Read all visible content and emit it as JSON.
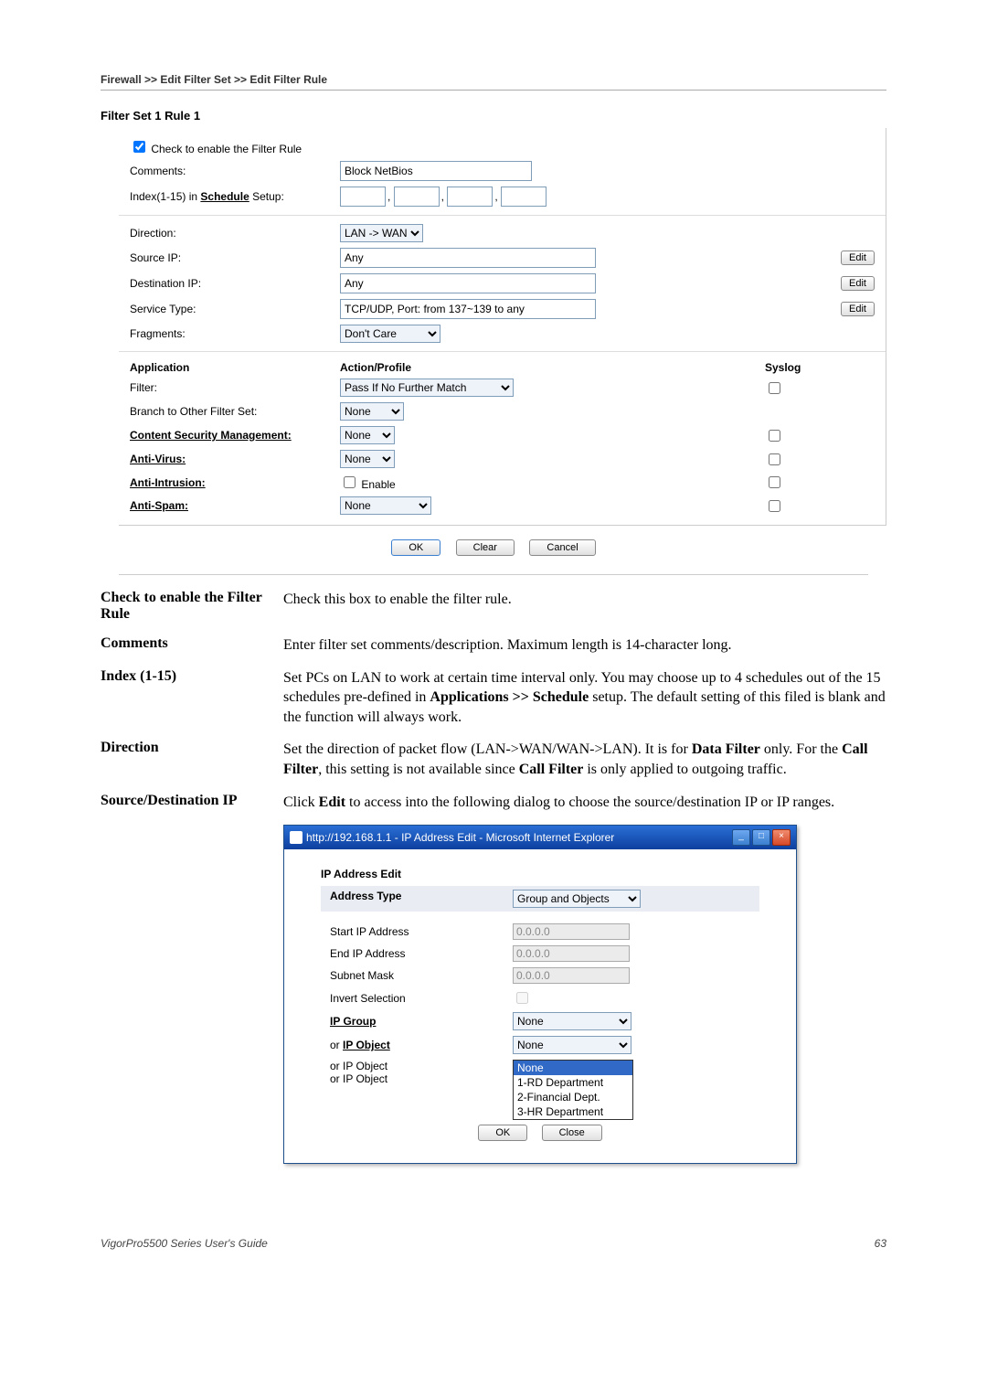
{
  "breadcrumb": "Firewall >> Edit Filter Set >> Edit Filter Rule",
  "filter_title": "Filter Set 1 Rule 1",
  "checkbox_label": "Check to enable the Filter Rule",
  "rows": {
    "comments_label": "Comments:",
    "comments_value": "Block NetBios",
    "index_label": "Index(1-15) in",
    "index_link": "Schedule",
    "index_suffix": "Setup:",
    "direction_label": "Direction:",
    "direction_value": "LAN -> WAN",
    "source_ip_label": "Source IP:",
    "source_ip_value": "Any",
    "dest_ip_label": "Destination IP:",
    "dest_ip_value": "Any",
    "service_type_label": "Service Type:",
    "service_type_value": "TCP/UDP, Port: from 137~139 to any",
    "fragments_label": "Fragments:",
    "fragments_value": "Don't Care",
    "edit_btn": "Edit"
  },
  "headers": {
    "application": "Application",
    "action_profile": "Action/Profile",
    "syslog": "Syslog"
  },
  "app_rows": {
    "filter_label": "Filter:",
    "filter_value": "Pass If No Further Match",
    "branch_label": "Branch to Other Filter Set:",
    "branch_value": "None",
    "csm_label": "Content Security Management:",
    "csm_value": "None",
    "av_label": "Anti-Virus:",
    "av_value": "None",
    "ai_label": "Anti-Intrusion:",
    "ai_checkbox": "Enable",
    "as_label": "Anti-Spam:",
    "as_value": "None"
  },
  "buttons": {
    "ok": "OK",
    "clear": "Clear",
    "cancel": "Cancel"
  },
  "descriptions": {
    "check_label": "Check to enable the Filter Rule",
    "check_text": "Check this box to enable the filter rule.",
    "comments_label": "Comments",
    "comments_text": "Enter filter set comments/description. Maximum length is 14-character long.",
    "index_label": "Index (1-15)",
    "index_text_pre": "Set PCs on LAN to work at certain time interval only. You may choose up to 4 schedules out of the 15 schedules pre-defined in ",
    "index_bold": "Applications >> Schedule",
    "index_text_post": " setup. The default setting of this filed is blank and the function will always work.",
    "direction_label": "Direction",
    "direction_text_pre": "Set the direction of packet flow (LAN->WAN/WAN->LAN). It is for ",
    "direction_b1": "Data Filter",
    "direction_mid1": " only. For the ",
    "direction_b2": "Call Filter",
    "direction_mid2": ", this setting is not available since ",
    "direction_b3": "Call Filter",
    "direction_post": " is only applied to outgoing traffic.",
    "srcdest_label": "Source/Destination IP",
    "srcdest_pre": "Click ",
    "srcdest_bold": "Edit",
    "srcdest_post": " to access into the following dialog to choose the source/destination IP or IP ranges."
  },
  "ie": {
    "title": "http://192.168.1.1 - IP Address Edit - Microsoft Internet Explorer",
    "section": "IP Address Edit",
    "address_type_label": "Address Type",
    "address_type_value": "Group and Objects",
    "start_ip_label": "Start IP Address",
    "end_ip_label": "End IP Address",
    "subnet_label": "Subnet Mask",
    "ip_zero": "0.0.0.0",
    "invert_label": "Invert Selection",
    "ip_group_label": "IP Group",
    "ip_group_value": "None",
    "or_ip_object_label": "or IP Object",
    "or_ip_object_value": "None",
    "dd_items": [
      "None",
      "1-RD Department",
      "2-Financial Dept.",
      "3-HR Department"
    ],
    "ok": "OK",
    "close": "Close"
  },
  "footer": {
    "left": "VigorPro5500 Series User's Guide",
    "right": "63"
  }
}
